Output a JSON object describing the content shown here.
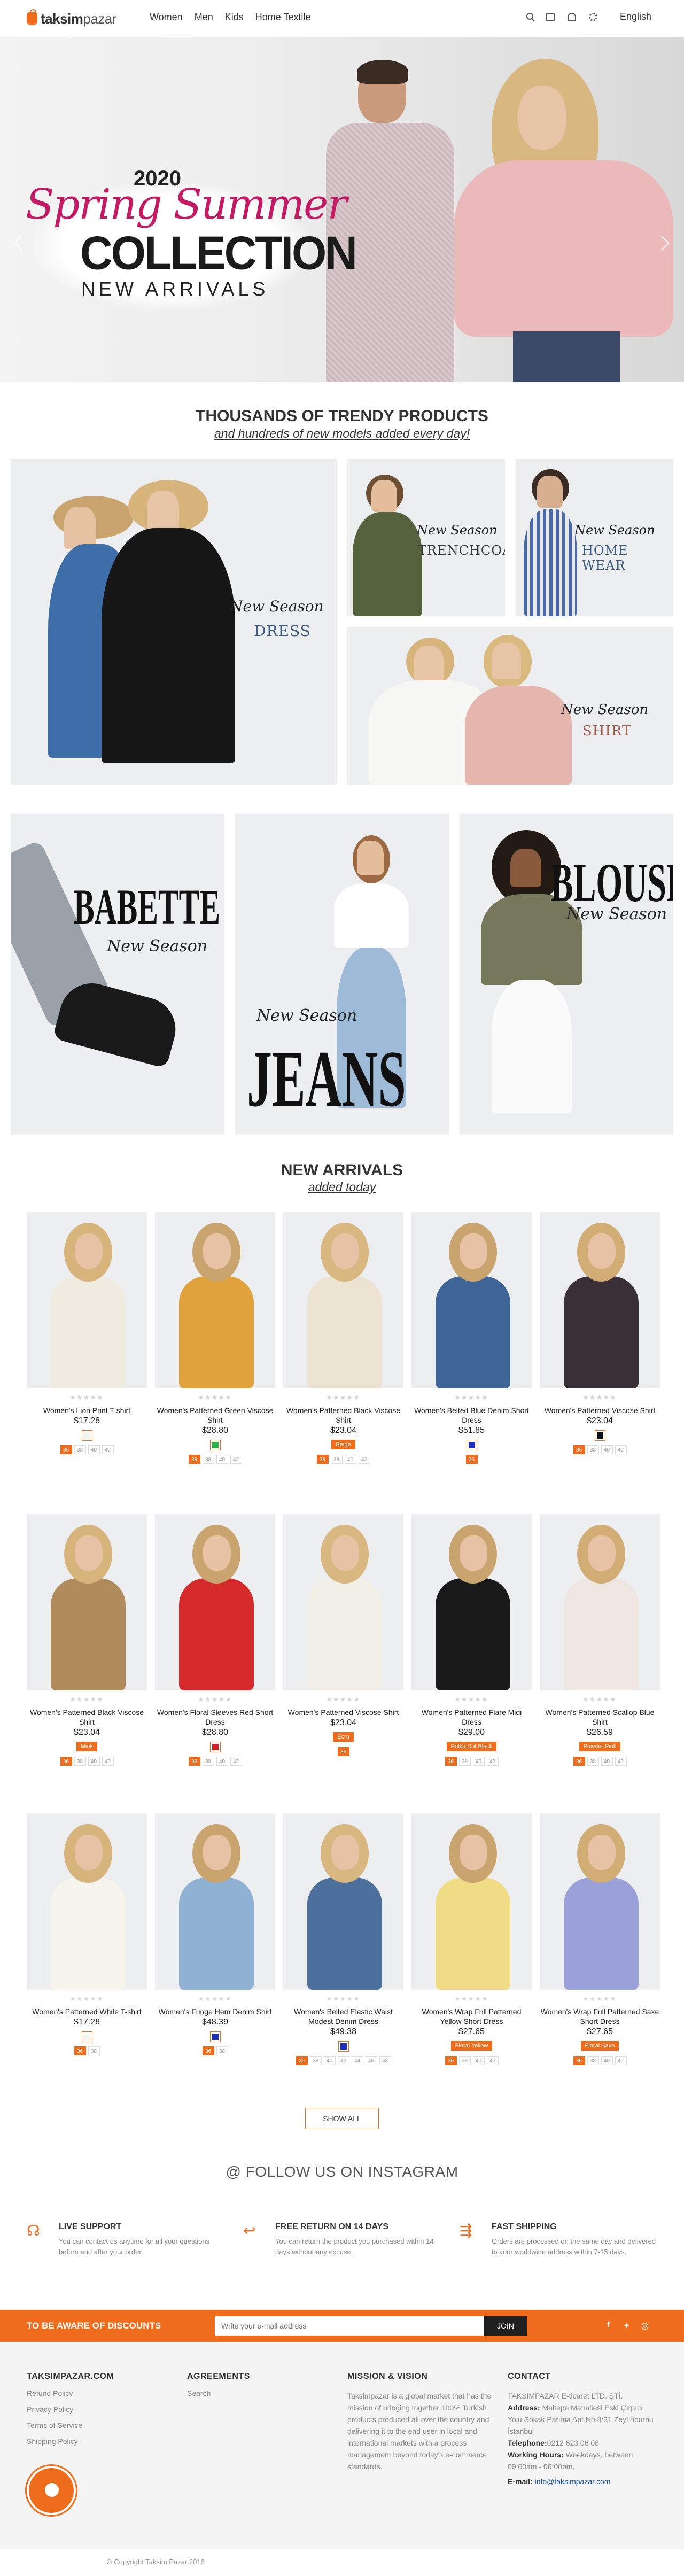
{
  "header": {
    "logo_strong": "taksim",
    "logo_light": "pazar",
    "nav": [
      "Women",
      "Men",
      "Kids",
      "Home Textile"
    ],
    "language": "English"
  },
  "hero": {
    "year": "2020",
    "script": "Spring Summer",
    "collection": "COLLECTION",
    "new_arrivals": "NEW ARRIVALS"
  },
  "trendy": {
    "title": "THOUSANDS OF TRENDY PRODUCTS",
    "subtitle": "and hundreds of new models added every day!"
  },
  "categories": {
    "new_season": "New Season",
    "dress": "DRESS",
    "trenchcoat": "TRENCHCOAT",
    "home_wear": "HOME WEAR",
    "shirt": "SHIRT",
    "babette": "BABETTE",
    "jeans": "JEANS",
    "blouse": "BLOUSE"
  },
  "arrivals": {
    "title": "NEW ARRIVALS",
    "subtitle": "added today"
  },
  "products": [
    {
      "name": "Women's Lion Print T-shirt",
      "price": "$17.28",
      "color": {
        "type": "swatch",
        "hex": "#f5f5f0"
      },
      "sizes": [
        "36",
        "38",
        "40",
        "42"
      ],
      "selected": 0
    },
    {
      "name": "Women's Patterned Green Viscose Shirt",
      "price": "$28.80",
      "color": {
        "type": "swatch",
        "hex": "#2db34a"
      },
      "sizes": [
        "36",
        "38",
        "40",
        "42"
      ],
      "selected": 0
    },
    {
      "name": "Women's Patterned Black Viscose Shirt",
      "price": "$23.04",
      "color": {
        "type": "tag",
        "label": "Beige"
      },
      "sizes": [
        "36",
        "38",
        "40",
        "42"
      ],
      "selected": 0
    },
    {
      "name": "Women's Belted Blue Denim Short Dress",
      "price": "$51.85",
      "color": {
        "type": "swatch",
        "hex": "#1f2fb8"
      },
      "sizes": [
        "36"
      ],
      "selected": 0
    },
    {
      "name": "Women's Patterned Viscose Shirt",
      "price": "$23.04",
      "color": {
        "type": "swatch",
        "hex": "#111111"
      },
      "sizes": [
        "36",
        "38",
        "40",
        "42"
      ],
      "selected": 0
    },
    {
      "name": "Women's Patterned Black Viscose Shirt",
      "price": "$23.04",
      "color": {
        "type": "tag",
        "label": "Mink"
      },
      "sizes": [
        "36",
        "38",
        "40",
        "42"
      ],
      "selected": 0
    },
    {
      "name": "Women's Floral Sleeves Red Short Dress",
      "price": "$28.80",
      "color": {
        "type": "swatch",
        "hex": "#d21f26"
      },
      "sizes": [
        "36",
        "38",
        "40",
        "42"
      ],
      "selected": 0
    },
    {
      "name": "Women's Patterned Viscose Shirt",
      "price": "$23.04",
      "color": {
        "type": "tag",
        "label": "Ecru"
      },
      "sizes": [
        "36"
      ],
      "selected": 0
    },
    {
      "name": "Women's Patterned Flare Midi Dress",
      "price": "$29.00",
      "color": {
        "type": "tag",
        "label": "Polka Dot Black"
      },
      "sizes": [
        "36",
        "38",
        "40",
        "42"
      ],
      "selected": 0
    },
    {
      "name": "Women's Patterned Scallop Blue Shirt",
      "price": "$26.59",
      "color": {
        "type": "tag",
        "label": "Powder Pink"
      },
      "sizes": [
        "36",
        "38",
        "40",
        "42"
      ],
      "selected": 0
    },
    {
      "name": "Women's Patterned White T-shirt",
      "price": "$17.28",
      "color": {
        "type": "swatch",
        "hex": "#f5f5f0"
      },
      "sizes": [
        "36",
        "38"
      ],
      "selected": 0
    },
    {
      "name": "Women's Fringe Hem Denim Shirt",
      "price": "$48.39",
      "color": {
        "type": "swatch",
        "hex": "#1f2fb8"
      },
      "sizes": [
        "36",
        "38"
      ],
      "selected": 0
    },
    {
      "name": "Women's Belted Elastic Waist Modest Denim Dress",
      "price": "$49.38",
      "color": {
        "type": "swatch",
        "hex": "#1f2fb8"
      },
      "sizes": [
        "36",
        "38",
        "40",
        "42",
        "44",
        "46",
        "48"
      ],
      "selected": 0
    },
    {
      "name": "Women's Wrap Frill Patterned Yellow Short Dress",
      "price": "$27.65",
      "color": {
        "type": "tag",
        "label": "Floral Yellow"
      },
      "sizes": [
        "36",
        "38",
        "40",
        "42"
      ],
      "selected": 0
    },
    {
      "name": "Women's Wrap Frill Patterned Saxe Short Dress",
      "price": "$27.65",
      "color": {
        "type": "tag",
        "label": "Floral Saxe"
      },
      "sizes": [
        "36",
        "38",
        "40",
        "42"
      ],
      "selected": 0
    }
  ],
  "show_all": "SHOW ALL",
  "instagram": "@ FOLLOW US ON INSTAGRAM",
  "features": [
    {
      "icon": "headset-icon",
      "title": "LIVE SUPPORT",
      "text": "You can contact us anytime for all your questions before and after your order."
    },
    {
      "icon": "return-icon",
      "title": "FREE RETURN ON 14 DAYS",
      "text": "You can return the product you purchased within 14 days without any excuse."
    },
    {
      "icon": "shipping-icon",
      "title": "FAST SHIPPING",
      "text": "Orders are processed on the same day and delivered to your worldwide address within 7-15 days."
    }
  ],
  "newsletter": {
    "title": "TO BE AWARE OF DISCOUNTS",
    "placeholder": "Write your e-mail address",
    "button": "JOIN"
  },
  "footer": {
    "col1_title": "TAKSIMPAZAR.COM",
    "col1_links": [
      "Refund Policy",
      "Privacy Policy",
      "Terms of Service",
      "Shipping Policy"
    ],
    "col2_title": "AGREEMENTS",
    "col2_links": [
      "Search"
    ],
    "col3_title": "MISSION & VISION",
    "col3_text": "Taksimpazar is a global market that has the mission of bringing together 100% Turkish products produced all over the country and delivering it to the end user in local and international markets with a process management beyond today's e-commerce standards.",
    "col4_title": "CONTACT",
    "company": "TAKSIMPAZAR E-ticaret LTD. ŞTİ.",
    "address_label": "Address:",
    "address": "Maltepe Mahallesi Eski Çırpıcı Yolu Sokak Parima Apt No:8/31 Zeytinburnu İstanbul",
    "phone_label": "Telephone:",
    "phone": "0212 623 06 08",
    "hours_label": "Working Hours:",
    "hours": "Weekdays, between 09:00am - 06:00pm.",
    "email_label": "E-mail:",
    "email": "info@taksimpazar.com"
  },
  "copyright": "© Copyright Taksim Pazar 2016"
}
